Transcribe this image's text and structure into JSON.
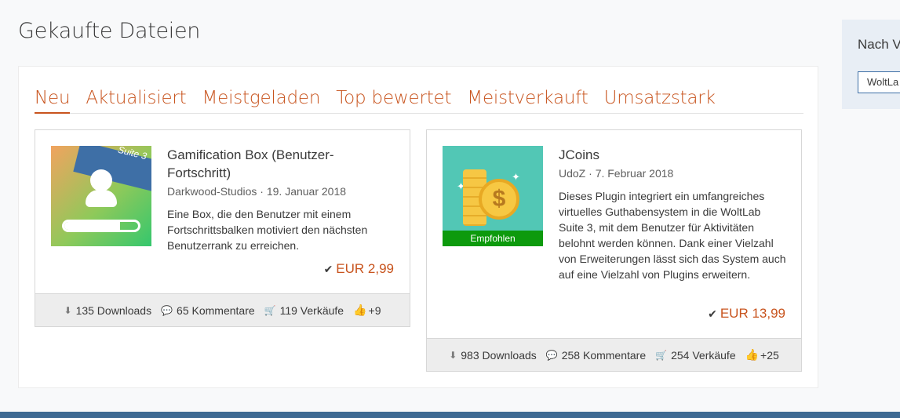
{
  "page": {
    "title": "Gekaufte Dateien"
  },
  "tabs": [
    {
      "label": "Neu",
      "active": true
    },
    {
      "label": "Aktualisiert"
    },
    {
      "label": "Meistgeladen"
    },
    {
      "label": "Top bewertet"
    },
    {
      "label": "Meistverkauft"
    },
    {
      "label": "Umsatzstark"
    }
  ],
  "files": [
    {
      "title": "Gamification Box (Benutzer-Fortschritt)",
      "author": "Darkwood-Studios",
      "date": "19. Januar 2018",
      "meta": "Darkwood-Studios · 19. Januar 2018",
      "thumb_label": "Suite 3",
      "description": "Eine Box, die den Benutzer mit einem Fortschrittsbalken motiviert den nächsten Benutzerrank zu erreichen.",
      "price": "EUR 2,99",
      "progress": 0.75,
      "stats": {
        "downloads": "135 Downloads",
        "comments": "65 Kommentare",
        "sales": "119 Verkäufe",
        "likes": "+9"
      }
    },
    {
      "title": "JCoins",
      "author": "UdoZ",
      "date": "7. Februar 2018",
      "meta": "UdoZ · 7. Februar 2018",
      "thumb_symbol": "$",
      "badge": "Empfohlen",
      "description": "Dieses Plugin integriert ein umfangreiches virtuelles Guthabensystem in die WoltLab Suite 3, mit dem Benutzer für Aktivitäten belohnt werden können. Dank einer Vielzahl von Erweiterungen lässt sich das System auch auf eine Vielzahl von Plugins erweitern.",
      "price": "EUR 13,99",
      "stats": {
        "downloads": "983 Downloads",
        "comments": "258 Kommentare",
        "sales": "254 Verkäufe",
        "likes": "+25"
      }
    }
  ],
  "sidebar": {
    "title": "Nach V",
    "select_value": "WoltLa"
  },
  "icons": {
    "download": "download-icon",
    "comment": "comments-icon",
    "cart": "shopping-cart-icon",
    "like": "thumbs-up-icon",
    "check": "check-icon"
  },
  "colors": {
    "accent": "#c8541e",
    "badge": "#0d9a0d",
    "footer": "#3e6a93"
  }
}
